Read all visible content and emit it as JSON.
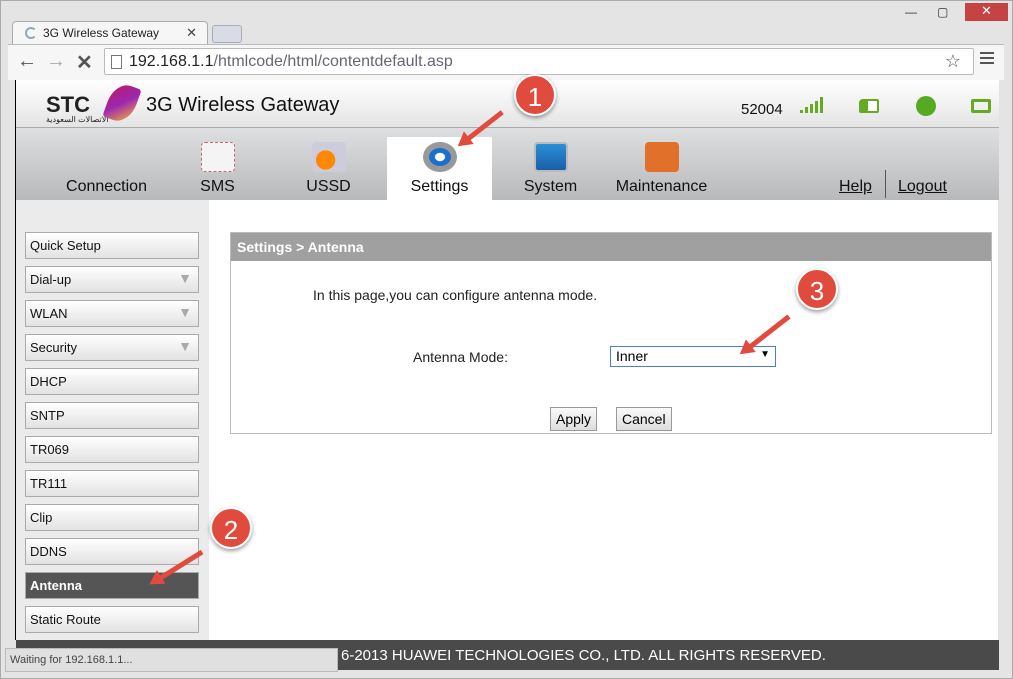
{
  "browser": {
    "tab_title": "3G Wireless Gateway",
    "url_host": "192.168.1.1",
    "url_path": "/htmlcode/html/contentdefault.asp",
    "status": "Waiting for 192.168.1.1..."
  },
  "header": {
    "logo": "STC",
    "logo_sub": "الاتصالات السعودية",
    "title": "3G Wireless Gateway",
    "network_code": "52004",
    "signal_bars": 5,
    "accent": "#66aa22"
  },
  "nav": {
    "items": [
      "Connection",
      "SMS",
      "USSD",
      "Settings",
      "System",
      "Maintenance"
    ],
    "selected": "Settings",
    "help": "Help",
    "logout": "Logout"
  },
  "sidebar": {
    "items": [
      {
        "label": "Quick Setup",
        "expandable": false
      },
      {
        "label": "Dial-up",
        "expandable": true
      },
      {
        "label": "WLAN",
        "expandable": true
      },
      {
        "label": "Security",
        "expandable": true
      },
      {
        "label": "DHCP",
        "expandable": false
      },
      {
        "label": "SNTP",
        "expandable": false
      },
      {
        "label": "TR069",
        "expandable": false
      },
      {
        "label": "TR111",
        "expandable": false
      },
      {
        "label": "Clip",
        "expandable": false
      },
      {
        "label": "DDNS",
        "expandable": false
      },
      {
        "label": "Antenna",
        "expandable": false
      },
      {
        "label": "Static Route",
        "expandable": false
      }
    ],
    "selected": "Antenna"
  },
  "content": {
    "breadcrumb": "Settings > Antenna",
    "intro": "In this page,you can configure antenna mode.",
    "mode_label": "Antenna Mode:",
    "mode_value": "Inner",
    "apply": "Apply",
    "cancel": "Cancel"
  },
  "footer": {
    "text": "6-2013 HUAWEI TECHNOLOGIES CO., LTD. ALL RIGHTS RESERVED."
  },
  "annotations": [
    "1",
    "2",
    "3"
  ]
}
